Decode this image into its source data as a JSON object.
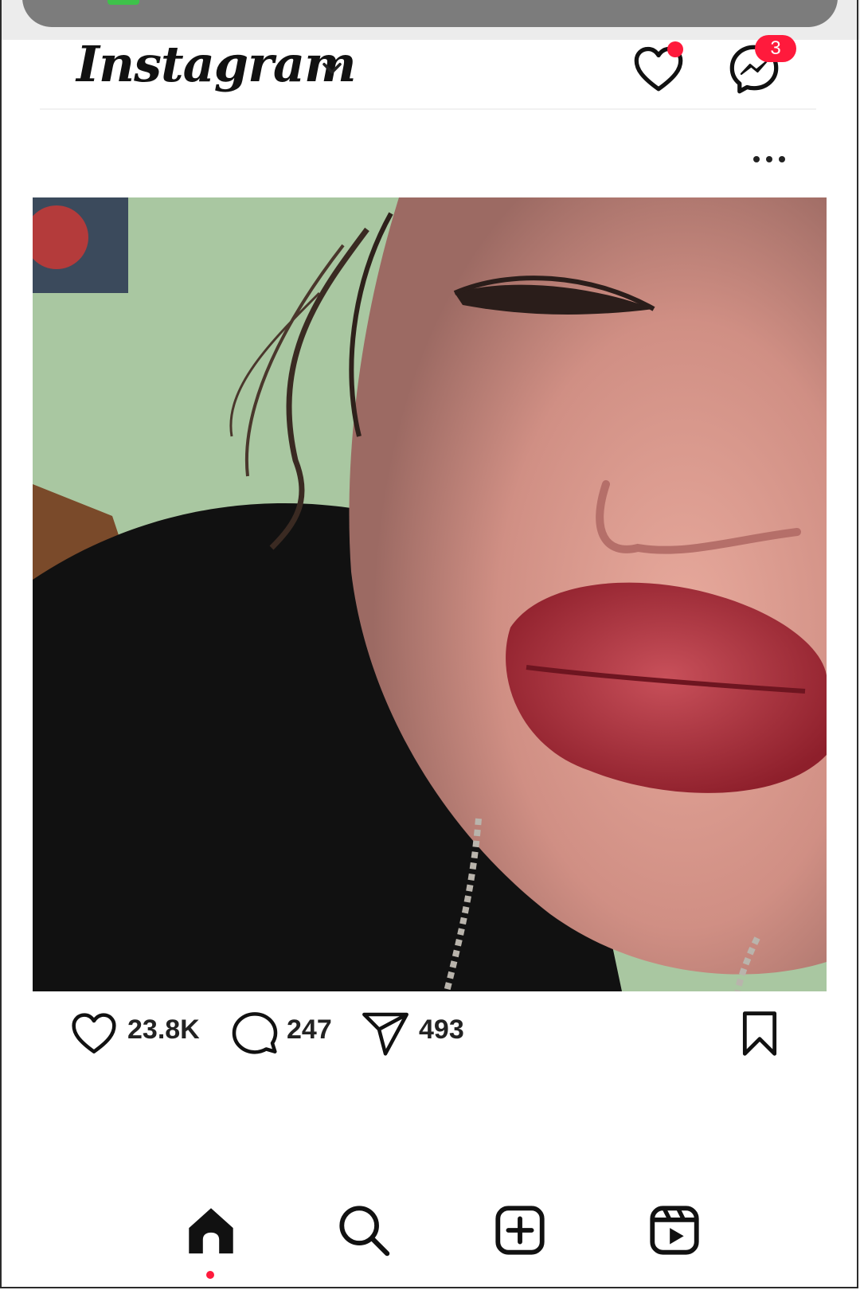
{
  "header": {
    "logo_text": "Instagram",
    "messages_badge": "3"
  },
  "post": {
    "likes": "23.8K",
    "comments": "247",
    "shares": "493"
  },
  "icons": {
    "header": [
      "chevron-down-icon",
      "heart-icon",
      "messenger-icon"
    ],
    "post_menu": "more-options-icon",
    "actions": [
      "heart-icon",
      "comment-icon",
      "share-icon",
      "bookmark-icon"
    ],
    "bottom_nav": [
      "home-icon",
      "search-icon",
      "create-icon",
      "reels-icon"
    ]
  },
  "colors": {
    "notification": "#ff1a3c",
    "text": "#111111",
    "background": "#ffffff"
  }
}
